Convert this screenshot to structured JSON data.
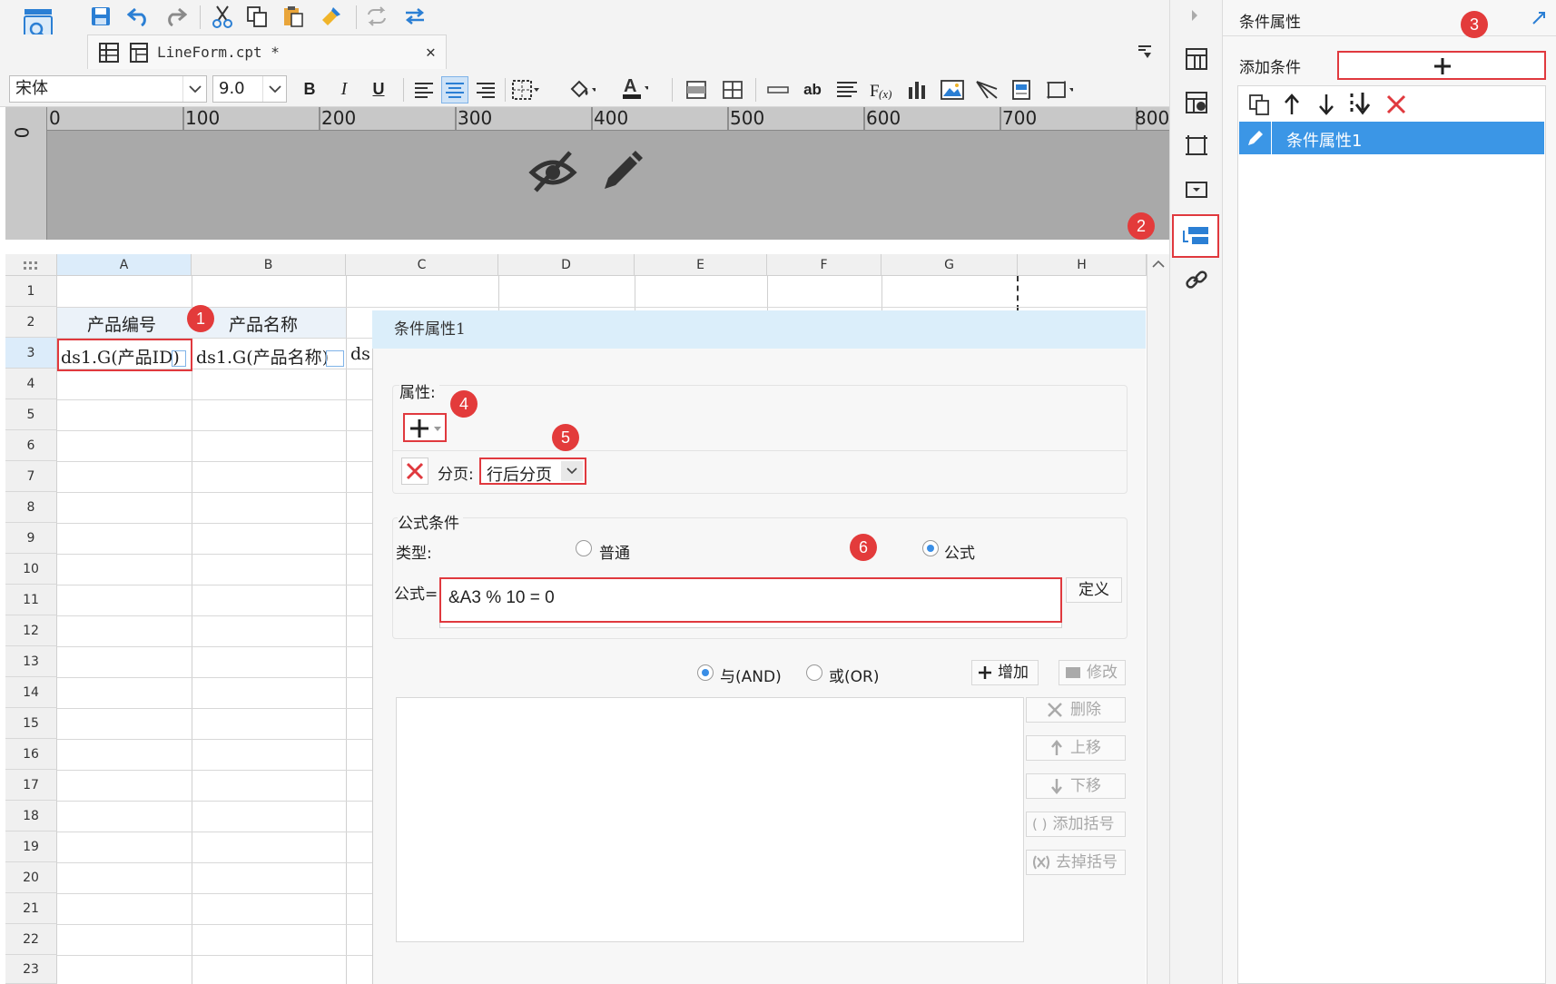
{
  "toolbar": {
    "file_tab": "LineForm.cpt *",
    "font_name": "宋体",
    "font_size": "9.0",
    "bold": "B",
    "italic": "I",
    "underline": "U",
    "ab_label": "ab"
  },
  "ruler": {
    "top_ticks": [
      "0",
      "100",
      "200",
      "300",
      "400",
      "500",
      "600",
      "700",
      "800"
    ],
    "left_tick": "0"
  },
  "grid": {
    "columns": [
      "A",
      "B",
      "C",
      "D",
      "E",
      "F",
      "G",
      "H"
    ],
    "rows": [
      "1",
      "2",
      "3",
      "4",
      "5",
      "6",
      "7",
      "8",
      "9",
      "10",
      "11",
      "12",
      "13",
      "14",
      "15",
      "16",
      "17",
      "18",
      "19",
      "20",
      "21",
      "22",
      "23"
    ],
    "cell_a2": "产品编号",
    "cell_b2": "产品名称",
    "cell_a3": "ds1.G(产品ID)",
    "cell_b3": "ds1.G(产品名称)",
    "cell_c3": "ds"
  },
  "dialog": {
    "title": "条件属性1",
    "attributes_label": "属性:",
    "paging_label": "分页:",
    "paging_value": "行后分页",
    "formula_section": "公式条件",
    "type_label": "类型:",
    "type_normal": "普通",
    "type_formula": "公式",
    "formula_label": "公式=",
    "formula_value": "&A3 % 10 = 0",
    "define_button": "定义",
    "and_label": "与(AND)",
    "or_label": "或(OR)",
    "add_button": "增加",
    "modify_button": "修改",
    "delete_button": "删除",
    "up_button": "上移",
    "down_button": "下移",
    "add_bracket_button": "添加括号",
    "remove_bracket_button": "去掉括号"
  },
  "right_panel": {
    "title": "条件属性",
    "add_condition_label": "添加条件",
    "list_item": "条件属性1"
  },
  "badges": [
    "1",
    "2",
    "3",
    "4",
    "5",
    "6"
  ],
  "colors": {
    "accent": "#3a8ee6",
    "highlight_red": "#e0393e",
    "selected_item": "#3b96e6",
    "dialog_title_bg": "#dbeefa",
    "ruler_bg": "#a9a9a9"
  }
}
